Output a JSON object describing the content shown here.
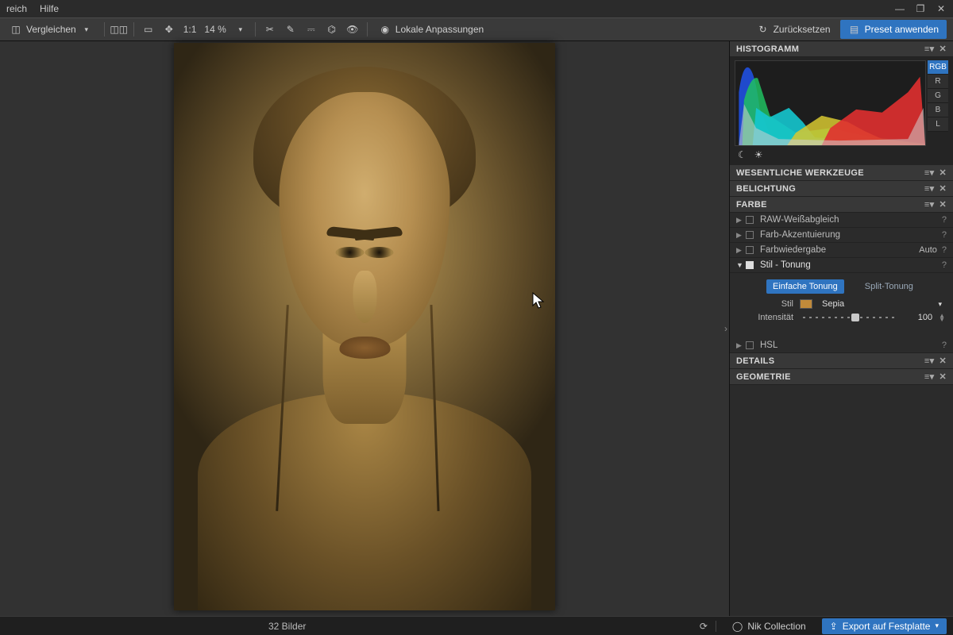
{
  "menu": {
    "items": [
      "reich",
      "Hilfe"
    ]
  },
  "window": {
    "minimize": "—",
    "maximize": "❐",
    "close": "✕"
  },
  "toolbar": {
    "compare": "Vergleichen",
    "ratio": "1:1",
    "zoom": "14 %",
    "local_adjust": "Lokale Anpassungen",
    "reset": "Zurücksetzen",
    "preset_apply": "Preset anwenden"
  },
  "panel": {
    "sections": {
      "histogram": "HISTOGRAMM",
      "essential": "WESENTLICHE WERKZEUGE",
      "exposure": "BELICHTUNG",
      "color": "FARBE",
      "details": "DETAILS",
      "geometry": "GEOMETRIE"
    },
    "channels": {
      "rgb": "RGB",
      "r": "R",
      "g": "G",
      "b": "B",
      "l": "L"
    },
    "color_items": {
      "raw_wb": "RAW-Weißabgleich",
      "accent": "Farb-Akzentuierung",
      "rendering": "Farbwiedergabe",
      "rendering_mode": "Auto",
      "toning": "Stil - Tonung",
      "hsl": "HSL"
    },
    "toning": {
      "tab_simple": "Einfache Tonung",
      "tab_split": "Split-Tonung",
      "style_label": "Stil",
      "style_value": "Sepia",
      "intensity_label": "Intensität",
      "intensity_value": "100"
    }
  },
  "footer": {
    "count": "32 Bilder",
    "nik": "Nik Collection",
    "export": "Export auf Festplatte"
  }
}
